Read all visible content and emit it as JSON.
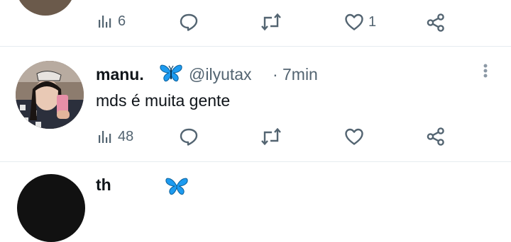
{
  "colors": {
    "text": "#0f1419",
    "muted": "#536471",
    "divider": "#e6ecf0",
    "butterfly": "#1d9bf0"
  },
  "top_tweet": {
    "views": "6",
    "likes": "1",
    "icons": [
      "views-icon",
      "reply-icon",
      "retweet-icon",
      "like-icon",
      "share-icon"
    ]
  },
  "tweet": {
    "display_name": "manu.",
    "emoji": "🦋",
    "handle": "@ilyutax",
    "separator": "·",
    "time": "7min",
    "text": "mds é muita gente",
    "views": "48",
    "icons": [
      "views-icon",
      "reply-icon",
      "retweet-icon",
      "like-icon",
      "share-icon",
      "more-icon"
    ]
  },
  "next_tweet": {
    "partial_name": "th",
    "emoji": "🦋"
  }
}
